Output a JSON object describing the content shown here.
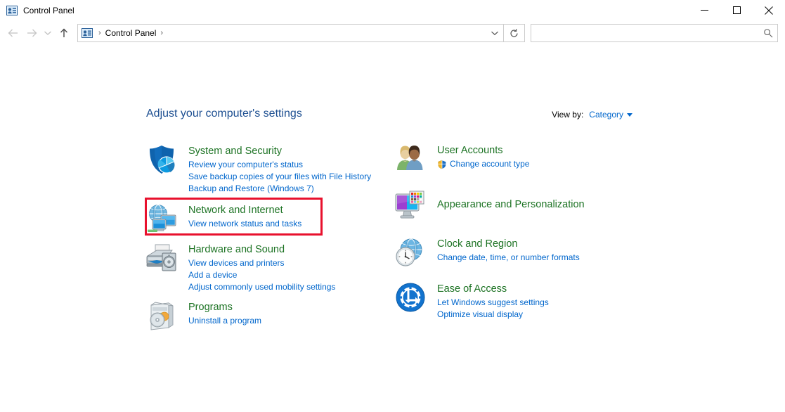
{
  "window": {
    "title": "Control Panel",
    "icon": "control-panel-icon",
    "controls": {
      "minimize": "Minimize",
      "maximize": "Maximize",
      "close": "Close"
    }
  },
  "navbar": {
    "back": "Back",
    "forward": "Forward",
    "recent": "Recent locations",
    "up": "Up one level",
    "breadcrumb": {
      "icon": "control-panel-icon",
      "separator": "›",
      "items": [
        "Control Panel"
      ]
    },
    "address_dropdown": "Previous locations",
    "refresh": "Refresh",
    "search": {
      "value": "",
      "placeholder": "",
      "icon": "search-icon"
    }
  },
  "main": {
    "page_title": "Adjust your computer's settings",
    "view_by": {
      "label": "View by:",
      "value": "Category"
    },
    "left_categories": [
      {
        "id": "system-and-security",
        "icon": "shield-icon",
        "title": "System and Security",
        "links": [
          "Review your computer's status",
          "Save backup copies of your files with File History",
          "Backup and Restore (Windows 7)"
        ]
      },
      {
        "id": "network-and-internet",
        "icon": "network-icon",
        "title": "Network and Internet",
        "links": [
          "View network status and tasks"
        ],
        "highlighted": true
      },
      {
        "id": "hardware-and-sound",
        "icon": "printer-icon",
        "title": "Hardware and Sound",
        "links": [
          "View devices and printers",
          "Add a device",
          "Adjust commonly used mobility settings"
        ]
      },
      {
        "id": "programs",
        "icon": "programs-icon",
        "title": "Programs",
        "links": [
          "Uninstall a program"
        ]
      }
    ],
    "right_categories": [
      {
        "id": "user-accounts",
        "icon": "users-icon",
        "title": "User Accounts",
        "links": [
          "Change account type"
        ],
        "link_shield": true
      },
      {
        "id": "appearance-and-personalization",
        "icon": "monitor-palette-icon",
        "title": "Appearance and Personalization",
        "links": []
      },
      {
        "id": "clock-and-region",
        "icon": "clock-globe-icon",
        "title": "Clock and Region",
        "links": [
          "Change date, time, or number formats"
        ]
      },
      {
        "id": "ease-of-access",
        "icon": "ease-of-access-icon",
        "title": "Ease of Access",
        "links": [
          "Let Windows suggest settings",
          "Optimize visual display"
        ]
      }
    ]
  },
  "annotation": {
    "type": "highlight-rectangle",
    "target": "network-and-internet",
    "color": "#e8112d"
  },
  "colors": {
    "category_title": "#1d7324",
    "link": "#0066cc",
    "page_title": "#1d4f91",
    "highlight": "#e8112d"
  }
}
